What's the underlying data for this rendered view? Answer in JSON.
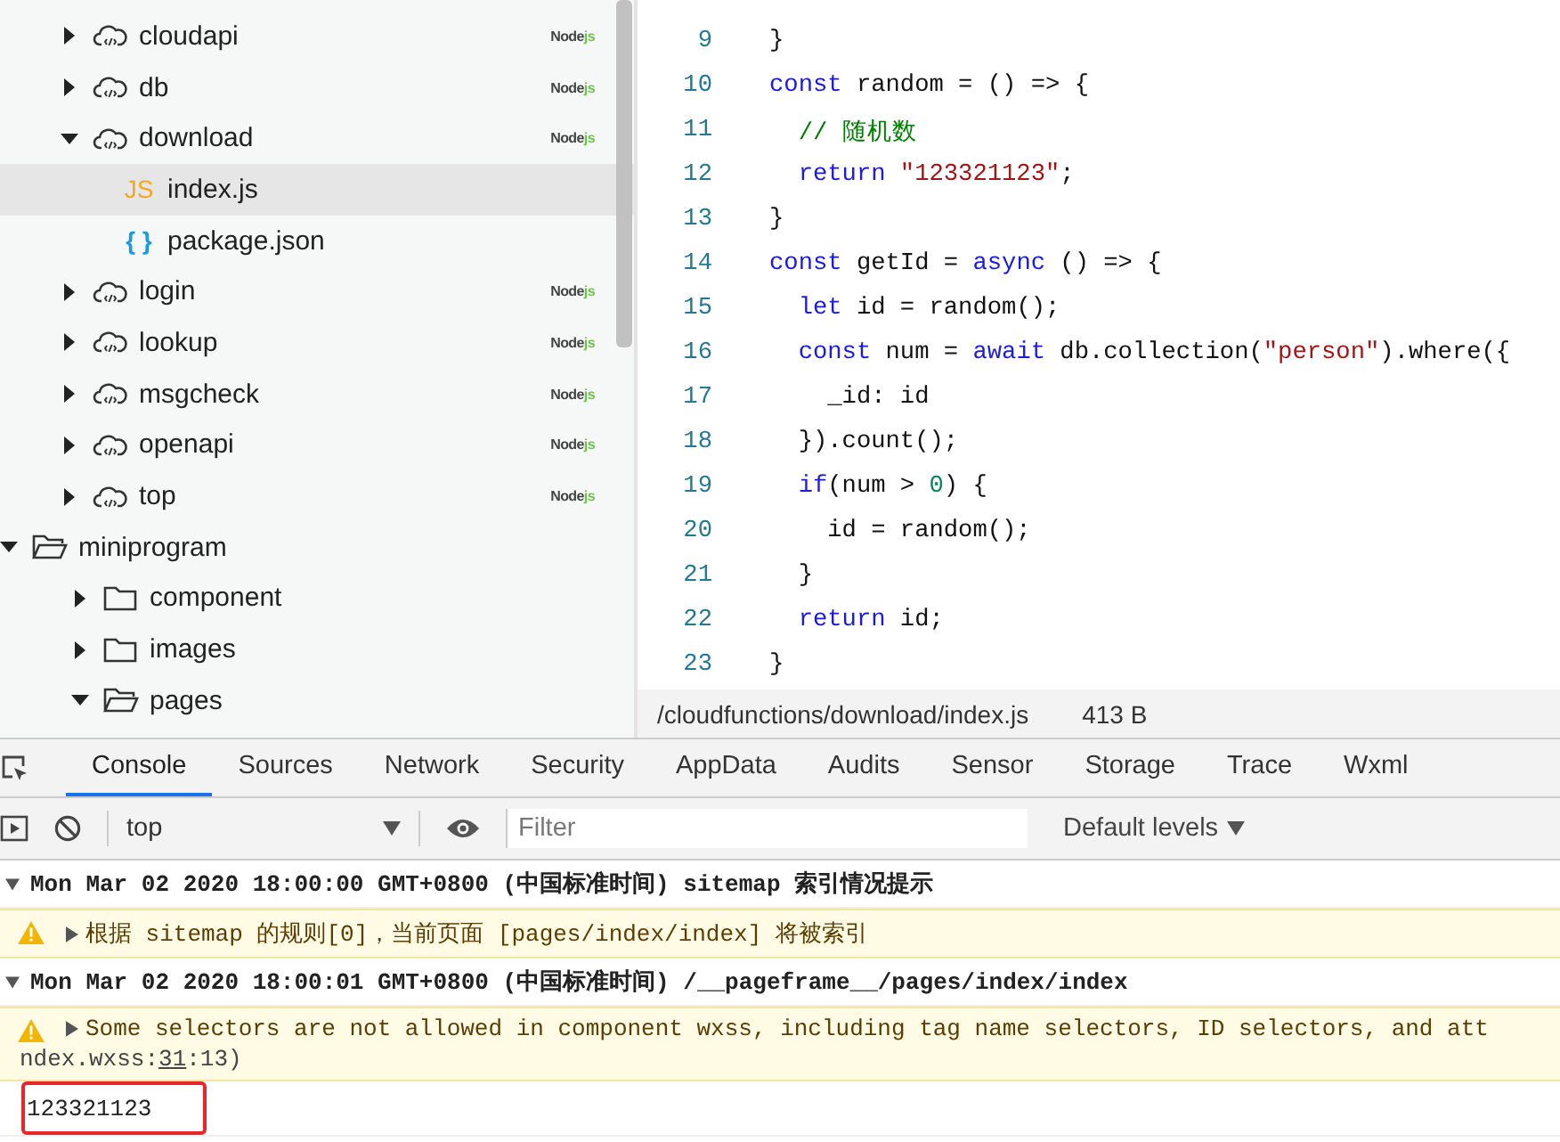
{
  "file_tree": [
    {
      "name": "cloudapi",
      "kind": "cloud",
      "expanded": false,
      "selected": false,
      "badge": {
        "node": "Node",
        "js": "js"
      }
    },
    {
      "name": "db",
      "kind": "cloud",
      "expanded": false,
      "selected": false,
      "badge": {
        "node": "Node",
        "js": "js"
      }
    },
    {
      "name": "download",
      "kind": "cloud",
      "expanded": true,
      "selected": false,
      "badge": {
        "node": "Node",
        "js": "js"
      },
      "children": [
        {
          "name": "index.js",
          "kind": "js",
          "icon_text": "JS",
          "selected": true
        },
        {
          "name": "package.json",
          "kind": "json",
          "icon_text": "{ }",
          "selected": false
        }
      ]
    },
    {
      "name": "login",
      "kind": "cloud",
      "expanded": false,
      "selected": false,
      "badge": {
        "node": "Node",
        "js": "js"
      }
    },
    {
      "name": "lookup",
      "kind": "cloud",
      "expanded": false,
      "selected": false,
      "badge": {
        "node": "Node",
        "js": "js"
      }
    },
    {
      "name": "msgcheck",
      "kind": "cloud",
      "expanded": false,
      "selected": false,
      "badge": {
        "node": "Node",
        "js": "js"
      }
    },
    {
      "name": "openapi",
      "kind": "cloud",
      "expanded": false,
      "selected": false,
      "badge": {
        "node": "Node",
        "js": "js"
      }
    },
    {
      "name": "top",
      "kind": "cloud",
      "expanded": false,
      "selected": false,
      "badge": {
        "node": "Node",
        "js": "js"
      }
    },
    {
      "name": "miniprogram",
      "kind": "folder",
      "expanded": true,
      "selected": false,
      "children": [
        {
          "name": "component",
          "kind": "folder",
          "expanded": false,
          "selected": false
        },
        {
          "name": "images",
          "kind": "folder",
          "expanded": false,
          "selected": false
        },
        {
          "name": "pages",
          "kind": "folder",
          "expanded": true,
          "selected": false
        }
      ]
    }
  ],
  "editor": {
    "lines": [
      {
        "number": "9",
        "tokens": [
          {
            "text": "}",
            "kind": "plain"
          }
        ]
      },
      {
        "number": "10",
        "tokens": [
          {
            "text": "const",
            "kind": "keyword"
          },
          {
            "text": " random = () => {",
            "kind": "plain"
          }
        ]
      },
      {
        "number": "11",
        "tokens": [
          {
            "text": "  // 随机数",
            "kind": "comment"
          }
        ]
      },
      {
        "number": "12",
        "tokens": [
          {
            "text": "  return ",
            "kind": "keyword"
          },
          {
            "text": "\"123321123\"",
            "kind": "string"
          },
          {
            "text": ";",
            "kind": "plain"
          }
        ]
      },
      {
        "number": "13",
        "tokens": [
          {
            "text": "}",
            "kind": "plain"
          }
        ]
      },
      {
        "number": "14",
        "tokens": [
          {
            "text": "const",
            "kind": "keyword"
          },
          {
            "text": " getId = ",
            "kind": "plain"
          },
          {
            "text": "async",
            "kind": "keyword"
          },
          {
            "text": " () => {",
            "kind": "plain"
          }
        ]
      },
      {
        "number": "15",
        "tokens": [
          {
            "text": "  let",
            "kind": "keyword"
          },
          {
            "text": " id = random();",
            "kind": "plain"
          }
        ]
      },
      {
        "number": "16",
        "tokens": [
          {
            "text": "  const",
            "kind": "keyword"
          },
          {
            "text": " num = ",
            "kind": "plain"
          },
          {
            "text": "await",
            "kind": "keyword"
          },
          {
            "text": " db.collection(",
            "kind": "plain"
          },
          {
            "text": "\"person\"",
            "kind": "string"
          },
          {
            "text": ").where({",
            "kind": "plain"
          }
        ]
      },
      {
        "number": "17",
        "tokens": [
          {
            "text": "    _id: id",
            "kind": "plain"
          }
        ]
      },
      {
        "number": "18",
        "tokens": [
          {
            "text": "  }).count();",
            "kind": "plain"
          }
        ]
      },
      {
        "number": "19",
        "tokens": [
          {
            "text": "  if",
            "kind": "keyword"
          },
          {
            "text": "(num > ",
            "kind": "plain"
          },
          {
            "text": "0",
            "kind": "number"
          },
          {
            "text": ") {",
            "kind": "plain"
          }
        ]
      },
      {
        "number": "20",
        "tokens": [
          {
            "text": "    id = random();",
            "kind": "plain"
          }
        ]
      },
      {
        "number": "21",
        "tokens": [
          {
            "text": "  }",
            "kind": "plain"
          }
        ]
      },
      {
        "number": "22",
        "tokens": [
          {
            "text": "  return",
            "kind": "keyword"
          },
          {
            "text": " id;",
            "kind": "plain"
          }
        ]
      },
      {
        "number": "23",
        "tokens": [
          {
            "text": "}",
            "kind": "plain"
          }
        ]
      }
    ],
    "status_bar": {
      "path": "/cloudfunctions/download/index.js",
      "size": "413 B"
    }
  },
  "devtools": {
    "tabs": [
      {
        "label": "Console",
        "selected": true
      },
      {
        "label": "Sources",
        "selected": false
      },
      {
        "label": "Network",
        "selected": false
      },
      {
        "label": "Security",
        "selected": false
      },
      {
        "label": "AppData",
        "selected": false
      },
      {
        "label": "Audits",
        "selected": false
      },
      {
        "label": "Sensor",
        "selected": false
      },
      {
        "label": "Storage",
        "selected": false
      },
      {
        "label": "Trace",
        "selected": false
      },
      {
        "label": "Wxml",
        "selected": false
      }
    ],
    "context": "top",
    "filter": {
      "placeholder": "Filter"
    },
    "levels": "Default levels",
    "messages": [
      {
        "kind": "group",
        "text": "Mon Mar 02 2020 18:00:00 GMT+0800 (中国标准时间) sitemap 索引情况提示"
      },
      {
        "kind": "warning",
        "text": "根据 sitemap 的规则[0]，当前页面 [pages/index/index] 将被索引"
      },
      {
        "kind": "group",
        "text": "Mon Mar 02 2020 18:00:01 GMT+0800 (中国标准时间) /__pageframe__/pages/index/index"
      },
      {
        "kind": "warning",
        "text": "Some selectors are not allowed in component wxss, including tag name selectors, ID selectors, and att",
        "source": {
          "before": "ndex.wxss:",
          "link": "31",
          "after": ":13)"
        }
      },
      {
        "kind": "log",
        "text": "123321123",
        "highlighted": true
      }
    ]
  }
}
